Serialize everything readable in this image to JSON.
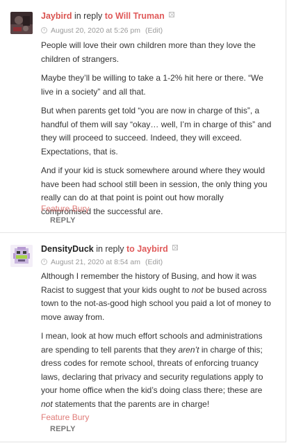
{
  "comments": [
    {
      "author": "Jaybird",
      "in_reply": "in reply",
      "to_target": "to Will Truman",
      "date": "August 20, 2020 at 5:26 pm",
      "edit": "(Edit)",
      "paragraphs": [
        "People will love their own children more than they love the children of strangers.",
        "Maybe they’ll be willing to take a 1-2% hit here or there. “We live in a society” and all that.",
        "But when parents get told “you are now in charge of this”, a handful of them will say “okay… well, I’m in charge of this” and they will proceed to succeed. Indeed, they will exceed. Expectations, that is.",
        "And if your kid is stuck somewhere around where they would have been had school still been in session, the only thing you really can do at that point is point out how morally compromised the successful are."
      ],
      "feature_bury": "Feature Bury",
      "reply": "REPLY"
    },
    {
      "author": "DensityDuck",
      "in_reply": "in reply",
      "to_target": "to Jaybird",
      "date": "August 21, 2020 at 8:54 am",
      "edit": "(Edit)",
      "p1_a": "Although I remember the history of Busing, and how it was Racist to suggest that your kids ought to ",
      "p1_em": "not",
      "p1_b": " be bused across town to the not-as-good high school you paid a lot of money to move away from.",
      "p2_a": "I mean, look at how much effort schools and administrations are spending to tell parents that they ",
      "p2_em1": "aren’t",
      "p2_b": " in charge of this; dress codes for remote school, threats of enforcing truancy laws, declaring that privacy and security regulations apply to your home office when the kid’s doing class there; these are ",
      "p2_em2": "not",
      "p2_c": " statements that the parents are in charge!",
      "feature_bury": "Feature Bury",
      "reply": "REPLY"
    }
  ],
  "colors": {
    "author_link": "#d9534f",
    "reply_target": "#e05a5a",
    "feature_bury": "#e07b78",
    "meta": "#9a9a9a"
  },
  "icons": [
    "clock-icon",
    "unlink-x-icon"
  ]
}
